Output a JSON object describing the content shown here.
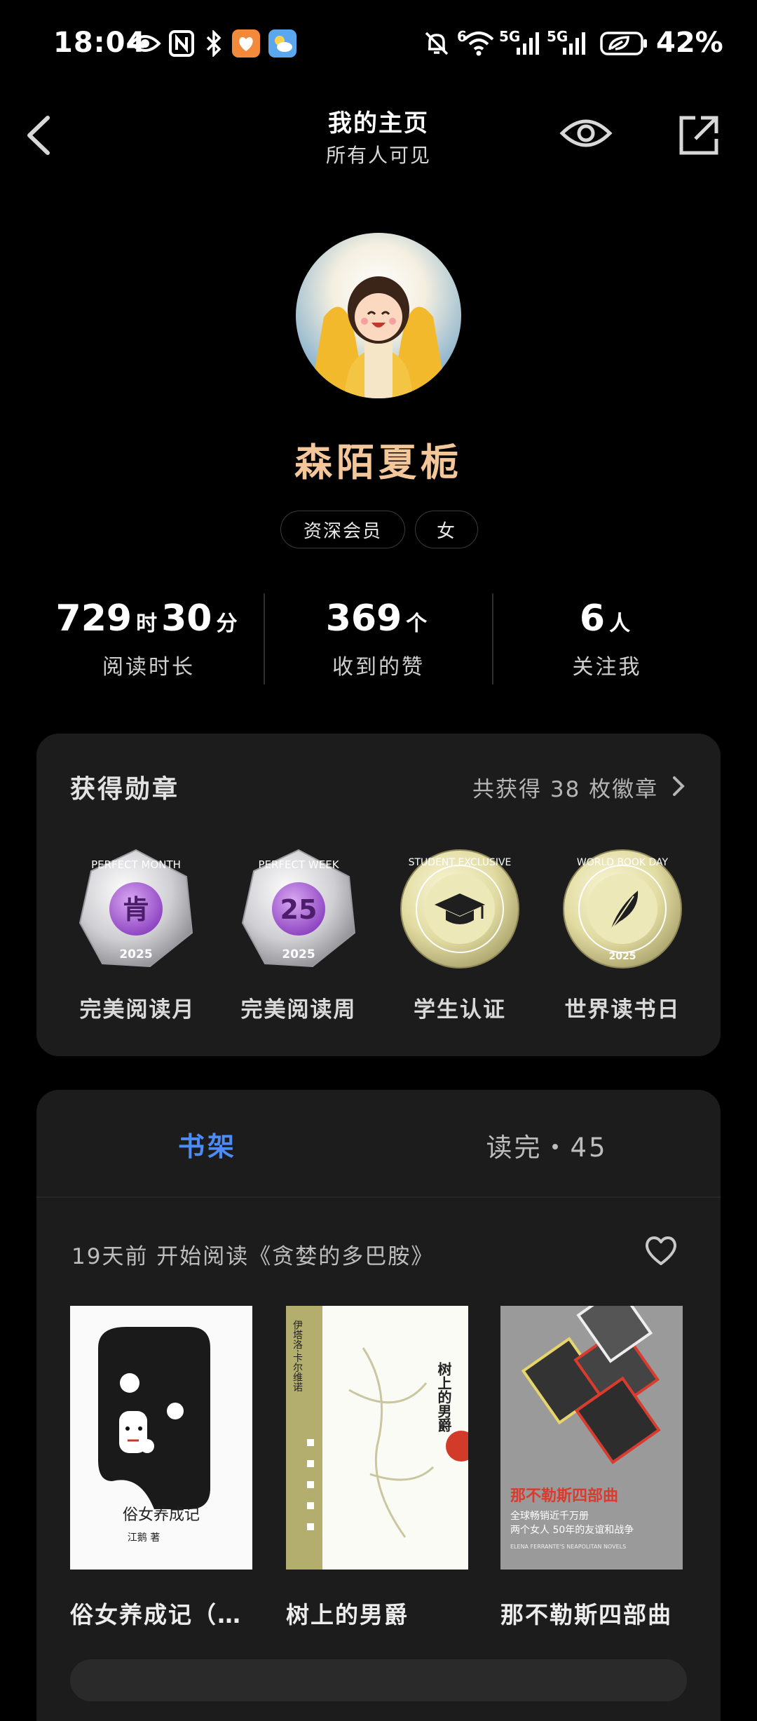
{
  "status_bar": {
    "time": "18:04",
    "battery_percent": "42%",
    "network_labels": [
      "6",
      "5G",
      "5G"
    ],
    "icons": [
      "eye-icon",
      "nfc-icon",
      "bluetooth-icon",
      "health-app-icon",
      "weather-app-icon",
      "mute-bell-icon",
      "wifi-icon",
      "signal-icon",
      "signal-icon",
      "battery-icon"
    ]
  },
  "header": {
    "title": "我的主页",
    "subtitle": "所有人可见",
    "back_icon": "back-chevron-icon",
    "eye_icon": "eye-icon",
    "share_icon": "share-icon"
  },
  "profile": {
    "username": "森陌夏栀",
    "tags": [
      "资深会员",
      "女"
    ],
    "name_color": "#f4c79a"
  },
  "stats": [
    {
      "value1": "729",
      "unit1": "时",
      "value2": "30",
      "unit2": "分",
      "label": "阅读时长"
    },
    {
      "value1": "369",
      "unit1": "个",
      "label": "收到的赞"
    },
    {
      "value1": "6",
      "unit1": "人",
      "label": "关注我"
    }
  ],
  "badges": {
    "title": "获得勋章",
    "count_text": "共获得 38 枚徽章",
    "items": [
      {
        "label": "完美阅读月",
        "ring_text": "PERFECT MONTH",
        "center": "肯",
        "year": "2025"
      },
      {
        "label": "完美阅读周",
        "ring_text": "PERFECT WEEK",
        "center": "25",
        "year": "2025"
      },
      {
        "label": "学生认证",
        "ring_text": "STUDENT EXCLUSIVE",
        "center_icon": "graduation-cap-icon"
      },
      {
        "label": "世界读书日",
        "ring_text": "WORLD BOOK DAY",
        "center_icon": "feather-icon",
        "year": "2025"
      }
    ]
  },
  "bookshelf": {
    "tabs": [
      "书架",
      "读完・45"
    ],
    "active_tab_color": "#4d8cf5",
    "recent_text": "19天前 开始阅读《贪婪的多巴胺》",
    "heart_icon": "heart-icon",
    "books": [
      {
        "title": "俗女养成记（…",
        "cover_title": "俗女养成记",
        "cover_author": "江鹅 著"
      },
      {
        "title": "树上的男爵",
        "cover_title": "树上的男爵",
        "cover_author": "伊塔洛·卡尔维诺"
      },
      {
        "title": "那不勒斯四部曲",
        "cover_title": "那不勒斯四部曲",
        "cover_sub1": "全球畅销近千万册",
        "cover_sub2": "两个女人 50年的友谊和战争",
        "cover_en": "ELENA FERRANTE'S NEAPOLITAN NOVELS"
      }
    ]
  }
}
